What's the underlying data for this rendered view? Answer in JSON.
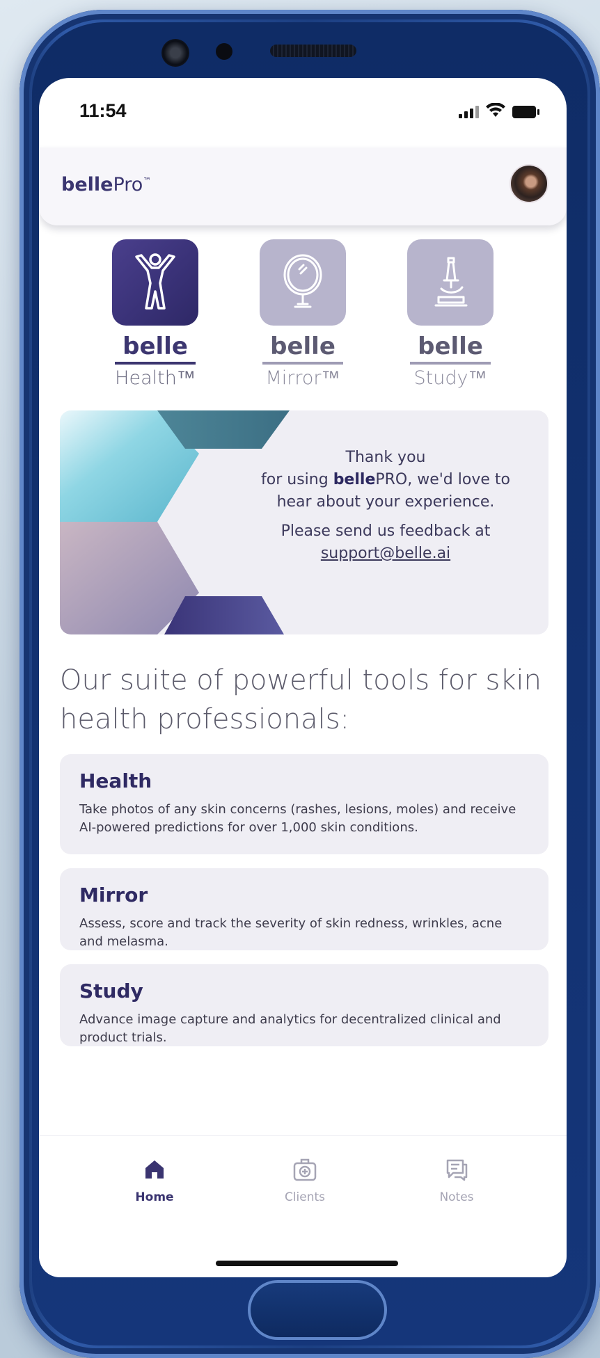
{
  "status_bar": {
    "time": "11:54",
    "icons": [
      "signal-icon",
      "wifi-icon",
      "battery-icon"
    ]
  },
  "header": {
    "brand_bold": "belle",
    "brand_rest": "Pro",
    "brand_mark": "™",
    "avatar_icon": "user-avatar"
  },
  "apps": [
    {
      "name": "belle",
      "sub": "Health™",
      "icon": "person-arms-up-icon",
      "active": true
    },
    {
      "name": "belle",
      "sub": "Mirror™",
      "icon": "mirror-icon",
      "active": false
    },
    {
      "name": "belle",
      "sub": "Study™",
      "icon": "microscope-icon",
      "active": false
    }
  ],
  "banner": {
    "line1": "Thank you",
    "line2_pre": "for using ",
    "line2_bold": "belle",
    "line2_post": "PRO, we'd love to",
    "line3": "hear about your experience.",
    "line4": "Please send us feedback at",
    "email": "support@belle.ai"
  },
  "suite_heading": "Our suite of powerful tools for skin health professionals:",
  "cards": [
    {
      "title": "Health",
      "desc": "Take photos of any skin concerns (rashes, lesions, moles) and receive AI-powered predictions for over 1,000 skin conditions."
    },
    {
      "title": "Mirror",
      "desc": "Assess, score and track the severity of skin redness, wrinkles, acne and melasma."
    },
    {
      "title": "Study",
      "desc": "Advance image capture and analytics for decentralized clinical and product trials."
    }
  ],
  "nav": [
    {
      "label": "Home",
      "icon": "home-icon",
      "active": true
    },
    {
      "label": "Clients",
      "icon": "medical-case-icon",
      "active": false
    },
    {
      "label": "Notes",
      "icon": "chat-notes-icon",
      "active": false
    }
  ],
  "colors": {
    "brand": "#3b3670",
    "card_bg": "#efeef4",
    "inactive_tile": "#b7b4cc"
  }
}
